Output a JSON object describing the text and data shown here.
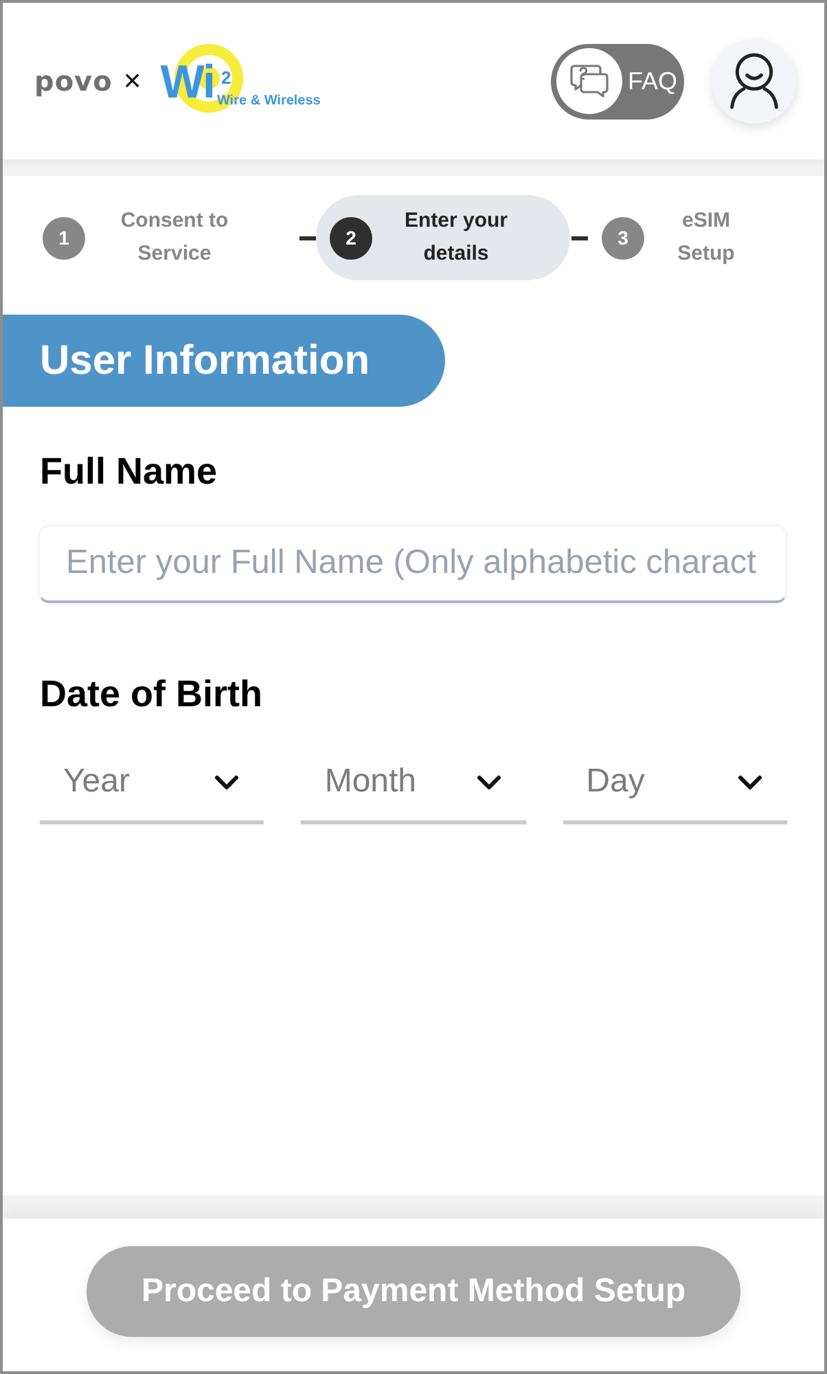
{
  "header": {
    "brand": {
      "primary": "povo",
      "separator": "×",
      "partner_name": "Wi",
      "partner_mark": "2",
      "partner_tagline": "Wire & Wireless"
    },
    "faq_button": {
      "label": "FAQ"
    }
  },
  "steps": [
    {
      "number": "1",
      "label": "Consent to\nService",
      "selected": false
    },
    {
      "number": "2",
      "label": "Enter your\ndetails",
      "selected": true
    },
    {
      "number": "3",
      "label": "eSIM\nSetup",
      "selected": false
    }
  ],
  "section": {
    "title": "User Information"
  },
  "form": {
    "full_name": {
      "label": "Full Name",
      "placeholder": "Enter your Full Name (Only alphabetic charact"
    },
    "date_of_birth": {
      "label": "Date of Birth",
      "selects": [
        {
          "placeholder": "Year"
        },
        {
          "placeholder": "Month"
        },
        {
          "placeholder": "Day"
        }
      ]
    }
  },
  "footer": {
    "button": {
      "label": "Proceed to Payment Method Setup",
      "disabled": true
    }
  }
}
